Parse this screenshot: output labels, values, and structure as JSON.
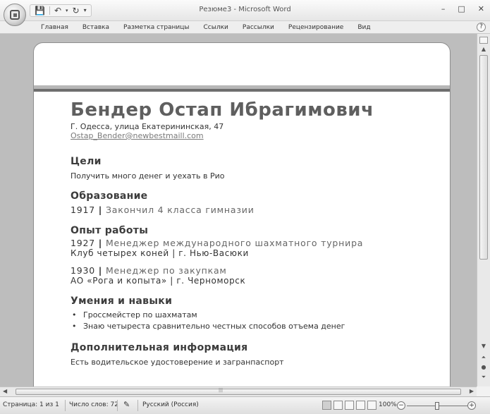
{
  "window": {
    "title": "Резюме3 - Microsoft Word",
    "controls": [
      "–",
      "□",
      "✕"
    ]
  },
  "quick_access": {
    "save_icon": "save-icon",
    "undo_icon": "undo-icon",
    "redo_icon": "redo-icon",
    "customize_icon": "qat-customize-icon"
  },
  "ribbon": {
    "tabs": [
      "Главная",
      "Вставка",
      "Разметка страницы",
      "Ссылки",
      "Рассылки",
      "Рецензирование",
      "Вид"
    ],
    "help": "?"
  },
  "resume": {
    "name": "Бендер Остап Ибрагимович",
    "address": "Г. Одесса, улица Екатерининская, 47",
    "email": "Ostap_Bender@newbestmaill.com",
    "sections": {
      "goals": {
        "heading": "Цели",
        "text": "Получить много денег и уехать в Рио"
      },
      "education": {
        "heading": "Образование",
        "year": "1917",
        "sep": "|",
        "text": "Закончил 4 класса гимназии"
      },
      "experience": {
        "heading": "Опыт работы",
        "jobs": [
          {
            "year": "1927",
            "sep": "|",
            "title": "Менеджер международного шахматного турнира",
            "org": "Клуб четырех коней | г. Нью-Васюки"
          },
          {
            "year": "1930",
            "sep": "|",
            "title": "Менеджер по закупкам",
            "org": "АО «Рога и копыта» | г. Черноморск"
          }
        ]
      },
      "skills": {
        "heading": "Умения и навыки",
        "items": [
          "Гроссмейстер по шахматам",
          "Знаю четыреста сравнительно честных способов отъема денег"
        ]
      },
      "additional": {
        "heading": "Дополнительная информация",
        "text": "Есть водительское удостоверение и загранпаспорт"
      }
    }
  },
  "statusbar": {
    "page": "Страница: 1 из 1",
    "words": "Число слов: 72",
    "language": "Русский (Россия)",
    "zoom": "100%",
    "zoom_minus": "−",
    "zoom_plus": "+"
  }
}
